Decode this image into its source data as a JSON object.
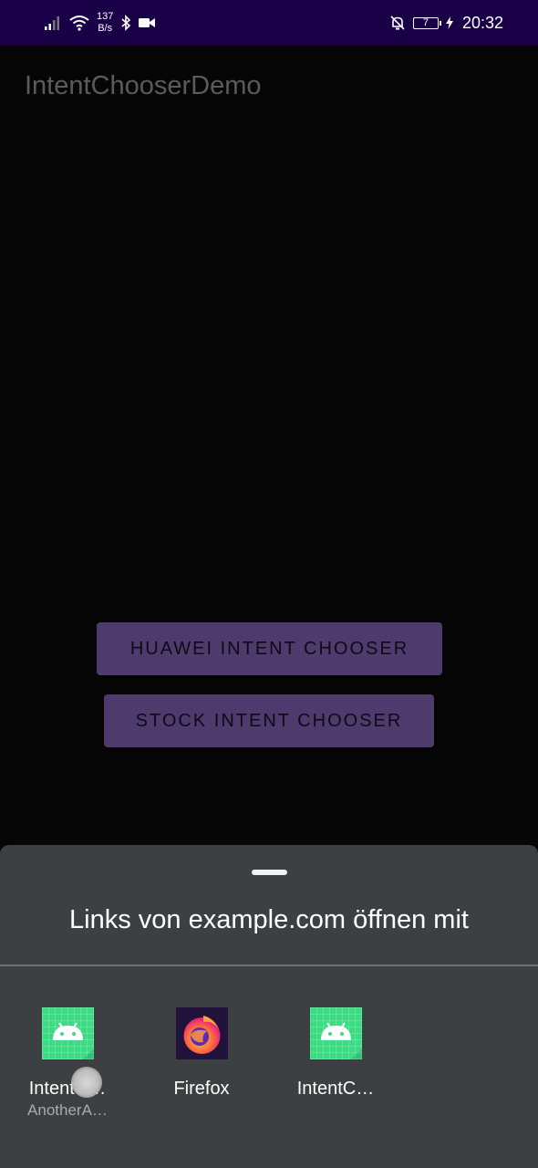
{
  "status_bar": {
    "network_speed_value": "137",
    "network_speed_unit": "B/s",
    "battery_level": "7",
    "time": "20:32",
    "icons": [
      "signal-icon",
      "wifi-icon",
      "bluetooth-icon",
      "video-camera-icon",
      "notifications-off-icon",
      "battery-icon",
      "charging-icon"
    ]
  },
  "app": {
    "title": "IntentChooserDemo",
    "buttons": {
      "huawei": "HUAWEI INTENT CHOOSER",
      "stock": "STOCK INTENT CHOOSER"
    },
    "button_color": "#4f3a6e"
  },
  "chooser": {
    "title": "Links von example.com öffnen mit",
    "targets": [
      {
        "label": "IntentC…",
        "sublabel": "AnotherA…",
        "icon": "android-app-icon"
      },
      {
        "label": "Firefox",
        "icon": "firefox-icon"
      },
      {
        "label": "IntentC…",
        "icon": "android-app-icon"
      }
    ],
    "sheet_color": "#3c4043"
  }
}
